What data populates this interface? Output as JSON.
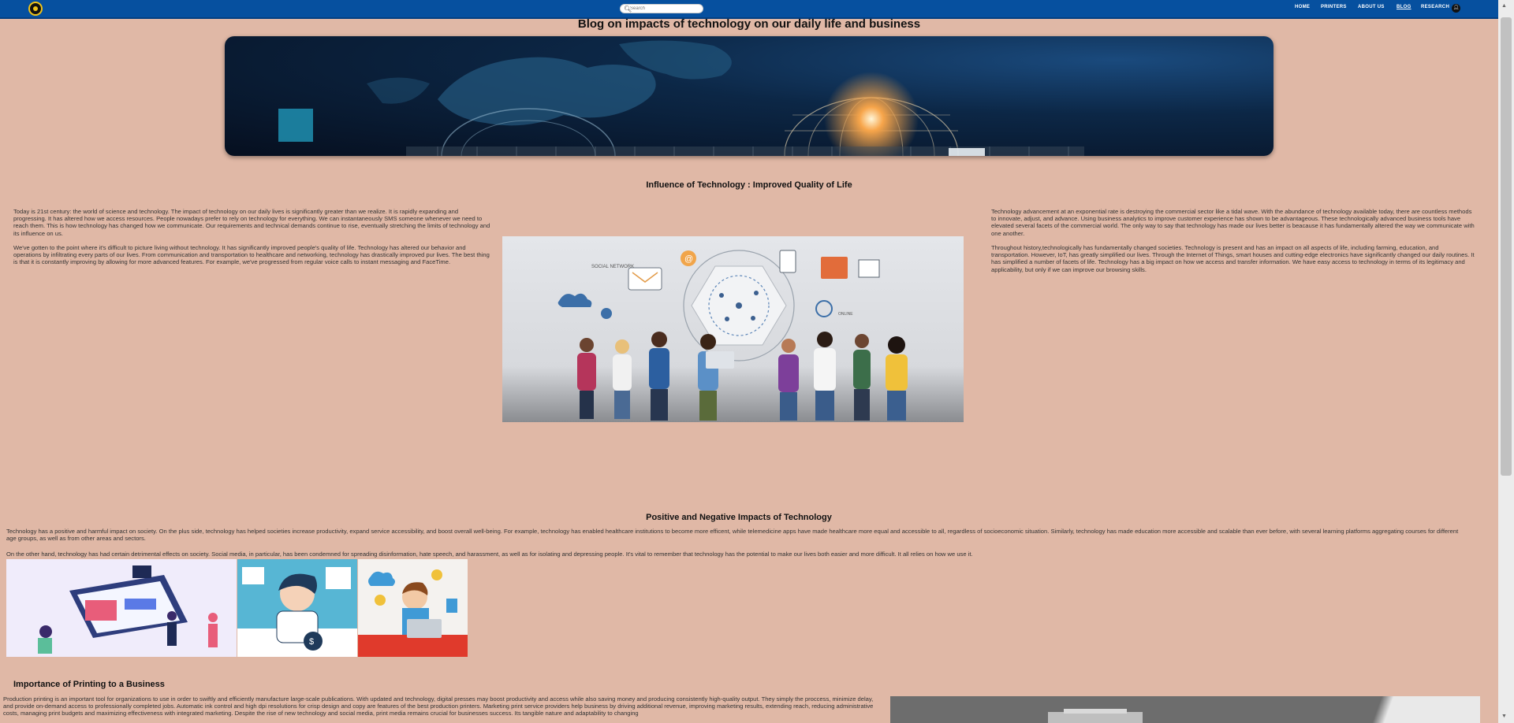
{
  "header": {
    "search_placeholder": "Search",
    "nav": [
      {
        "label": "HOME"
      },
      {
        "label": "PRINTERS"
      },
      {
        "label": "ABOUT US"
      },
      {
        "label": "BLOG"
      },
      {
        "label": "RESEARCH"
      }
    ]
  },
  "page": {
    "title": "Blog on impacts of technology on our daily life and business"
  },
  "section1": {
    "title": "Influence of Technology : Improved Quality of Life",
    "left_p1": "Today is 21st century: the world of science and technology. The impact of technology on our daily lives is significantly greater than we realize. It is rapidly expanding and progressing. It has altered how we access resources. People nowadays prefer to rely on technology for everything. We can instantaneously SMS someone whenever we need to reach them. This is how technology has changed how we communicate. Our requirements and technical demands continue to rise, eventually stretching the limits of technology and its influence on us.",
    "left_p2": "We've gotten to the point where it's difficult to picture living without technology. It has significantly improved people's quality of life. Technology has altered our behavior and operations by infiltrating every parts of our lives. From communication and transportation to healthcare and networking, technology has drastically improved pur lives. The best thing is that it is constantly improving by allowing for more advanced features. For example, we've progressed from regular voice calls to instant messaging and FaceTime.",
    "right_p1": "Technology advancement at an exponential rate is destroying the commercial sector like a tidal wave. With the abundance of technology available today, there are countless methods to innovate, adjust, and advance. Using business analytics to improve customer experience has shown to be advantageous. These technologically advanced business tools have elevated several facets of the commercial world. The only way to say that technology has made our lives better is beacause it has fundamentally altered the way we communicate with one another.",
    "right_p2": "Throughout history,technologically has fundamentally changed societies. Technology is present and has an impact on all aspects of life, including farming, education, and transportation. However, IoT, has greatly simplified our lives. Through the Internet of Things, smart houses and cutting-edge electronics have significantly changed our daily routines. It has simplified a number of facets of life. Technology has a big impact on how we access and transfer information. We have easy access to technology in terms of its legitimacy and applicability, but only if we can improve our browsing skills.",
    "image_labels": {
      "social": "SOCIAL NETWORK",
      "online": "ONLINE"
    }
  },
  "section2": {
    "title": "Positive and Negative Impacts of Technology",
    "p1": "Technology has a positive and harmful impact on society. On the plus side, technology has helped societies increase productivity, expand service accessibility, and boost overall well-being. For example, technology has enabled healthcare institutions to become more efficent, while telemedicine apps have made healthcare more equal and accessible to all, regardless of socioeconomic situation. Similarly, technology has made education more accessible and scalable than ever before, with several learning platforms aggregating courses for different age groups, as well as from other areas and sectors.",
    "p2": "On the other hand, technology has had certain detrimental effects on society. Social media, in particular, has been condemned for spreading disinformation, hate speech, and harassment, as well as for isolating and depressing people. It's vital to remember that technology has the potential to make our lives both easier and more difficult. It all relies on how we use it."
  },
  "section3": {
    "title": "Importance of Printing to a Business",
    "p1": "Production printing is an important tool for organizations to use in order to swiftly and efficiently manufacture large-scale publications. With updated and technology, digital presses may boost productivity and access while also saving money and producing consistently high-quality output. They simply the proccess, minimize delay, and provide on-demand access to professionally completed jobs. Automatic ink control and high dpi resolutions for crisp design and copy are features of the best production printers. Marketing print service providers help business by driving additional revenue, improving marketing results, extending reach, reducing administrative costs, managing print budgets and maximizing effectiveness with integrated marketing. Despite the rise of new technology and social media, print media remains crucial for businesses success. Its tangible nature and adaptability to changing"
  },
  "colors": {
    "background": "#e0b8a6",
    "header": "#06509f",
    "text": "#333333"
  }
}
